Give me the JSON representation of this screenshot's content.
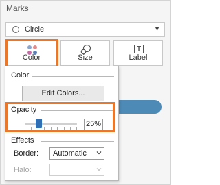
{
  "marks": {
    "title": "Marks",
    "mark_type": "Circle",
    "cards": [
      {
        "label": "Color",
        "icon": "color-dots-icon"
      },
      {
        "label": "Size",
        "icon": "size-icon"
      },
      {
        "label": "Label",
        "icon": "label-icon"
      }
    ],
    "label_icon_glyph": "T"
  },
  "color_popup": {
    "color_heading": "Color",
    "edit_colors_label": "Edit Colors...",
    "opacity_heading": "Opacity",
    "opacity_value": "25%",
    "opacity_fraction": 0.25,
    "effects_heading": "Effects",
    "border_label": "Border:",
    "border_value": "Automatic",
    "halo_label": "Halo:",
    "halo_value": ""
  },
  "colors": {
    "highlight": "#e8792c",
    "slider_thumb": "#2f6fb3",
    "pill": "#4e8ab6"
  }
}
